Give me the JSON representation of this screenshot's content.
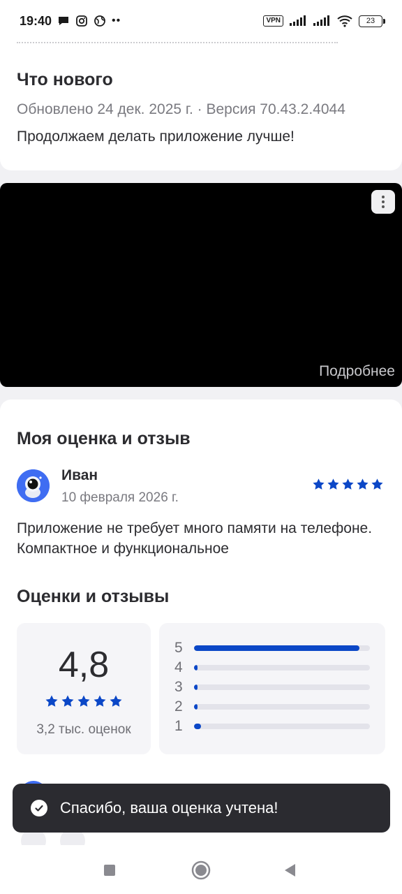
{
  "status_bar": {
    "time": "19:40",
    "vpn_label": "VPN",
    "battery_level": "23",
    "icons": [
      "chat-icon",
      "instagram-icon",
      "vpn-globe-icon",
      "more-dots-icon",
      "signal-icon",
      "signal-icon",
      "wifi-icon",
      "battery-icon"
    ]
  },
  "whats_new": {
    "title": "Что нового",
    "meta": "Обновлено 24 дек. 2025 г. · Версия 70.43.2.4044",
    "description": "Продолжаем делать приложение лучше!"
  },
  "video": {
    "more_label": "Подробнее",
    "menu_icon": "kebab-menu-icon"
  },
  "my_review": {
    "section_title": "Моя оценка и отзыв",
    "author": "Иван",
    "date": "10 февраля 2026 г.",
    "stars": 5,
    "text": "Приложение не требует много памяти на телефоне. Компактное и функциональное"
  },
  "ratings": {
    "section_title": "Оценки и отзывы",
    "average": "4,8",
    "stars": 5,
    "count_label": "3,2 тыс. оценок",
    "distribution": [
      {
        "label": "5",
        "fraction": 0.94
      },
      {
        "label": "4",
        "fraction": 0.01
      },
      {
        "label": "3",
        "fraction": 0.01
      },
      {
        "label": "2",
        "fraction": 0.01
      },
      {
        "label": "1",
        "fraction": 0.04
      }
    ]
  },
  "toast": {
    "message": "Спасибо, ваша оценка учтена!",
    "icon": "check-circle-icon"
  },
  "nav": {
    "buttons": [
      "recent-apps-icon",
      "home-icon",
      "back-icon"
    ]
  },
  "colors": {
    "accent": "#0b47c7",
    "toast_bg": "#2b2b30",
    "avatar_bg": "#3f6df2"
  }
}
